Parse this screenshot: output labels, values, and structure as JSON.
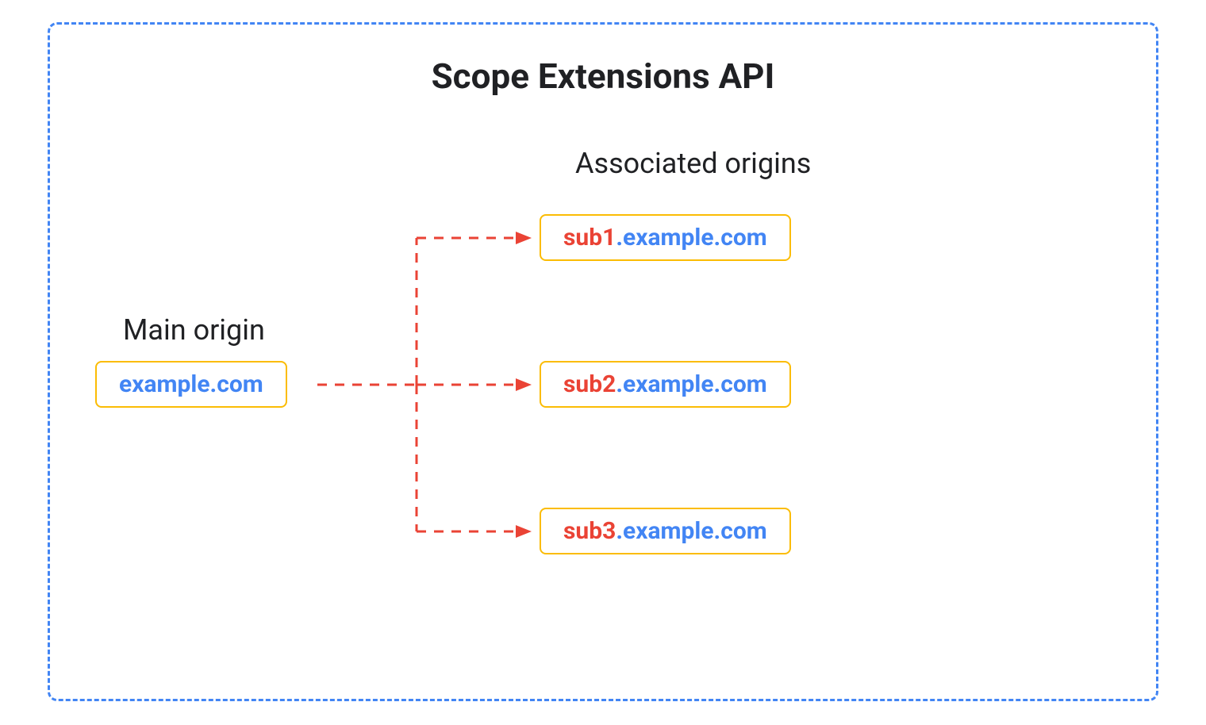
{
  "title": "Scope Extensions API",
  "mainOrigin": {
    "label": "Main origin",
    "domain": "example.com"
  },
  "associatedOrigins": {
    "label": "Associated origins",
    "items": [
      {
        "prefix": "sub1",
        "suffix": ".example.com"
      },
      {
        "prefix": "sub2",
        "suffix": ".example.com"
      },
      {
        "prefix": "sub3",
        "suffix": ".example.com"
      }
    ]
  },
  "colors": {
    "borderBlue": "#4285f4",
    "boxOrange": "#fbbc04",
    "textBlue": "#4285f4",
    "textRed": "#ea4335",
    "arrowRed": "#ea4335"
  }
}
